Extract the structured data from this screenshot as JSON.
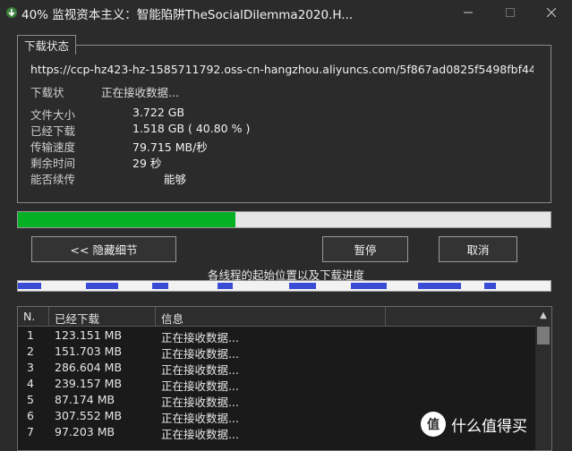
{
  "window": {
    "title": "40% 监视资本主义：智能陷阱TheSocialDilemma2020.H...",
    "minimize_icon": "minimize-icon",
    "maximize_icon": "maximize-icon",
    "close_icon": "close-icon"
  },
  "status_group": {
    "tab_label": "下载状态",
    "url": "https://ccp-hz423-hz-1585711792.oss-cn-hangzhou.aliyuncs.com/5f867ad0825f5498fbf44",
    "status_label": "下载状",
    "status_value": "正在接收数据...",
    "rows": [
      {
        "label": "文件大小",
        "value": "3.722  GB"
      },
      {
        "label": "已经下载",
        "value": "1.518  GB  ( 40.80 % )"
      },
      {
        "label": "传输速度",
        "value": "79.715  MB/秒"
      },
      {
        "label": "剩余时间",
        "value": "29 秒"
      },
      {
        "label": "能否续传",
        "value": "能够"
      }
    ]
  },
  "progress": {
    "fraction": 0.408,
    "fill_color": "#06b025"
  },
  "buttons": {
    "hide_details": "<< 隐藏细节",
    "pause": "暂停",
    "cancel": "取消"
  },
  "threads": {
    "caption": "各线程的起始位置以及下载进度",
    "segment_color": "#3a4bd6",
    "segments": [
      {
        "start": 0.0,
        "progress": 0.043
      },
      {
        "start": 0.128,
        "progress": 0.061
      },
      {
        "start": 0.252,
        "progress": 0.03
      },
      {
        "start": 0.375,
        "progress": 0.028
      },
      {
        "start": 0.51,
        "progress": 0.05
      },
      {
        "start": 0.626,
        "progress": 0.068
      },
      {
        "start": 0.751,
        "progress": 0.08
      },
      {
        "start": 0.876,
        "progress": 0.022
      }
    ]
  },
  "thread_list": {
    "headers": [
      "N.",
      "已经下载",
      "信息"
    ],
    "rows": [
      {
        "n": "1",
        "downloaded": "123.151  MB",
        "info": "正在接收数据..."
      },
      {
        "n": "2",
        "downloaded": "151.703  MB",
        "info": "正在接收数据..."
      },
      {
        "n": "3",
        "downloaded": "286.604  MB",
        "info": "正在接收数据..."
      },
      {
        "n": "4",
        "downloaded": "239.157  MB",
        "info": "正在接收数据..."
      },
      {
        "n": "5",
        "downloaded": "87.174  MB",
        "info": "正在接收数据..."
      },
      {
        "n": "6",
        "downloaded": "307.552  MB",
        "info": "正在接收数据..."
      },
      {
        "n": "7",
        "downloaded": "97.203  MB",
        "info": "正在接收数据..."
      }
    ]
  },
  "watermark": {
    "logo": "值",
    "text": "什么值得买"
  }
}
